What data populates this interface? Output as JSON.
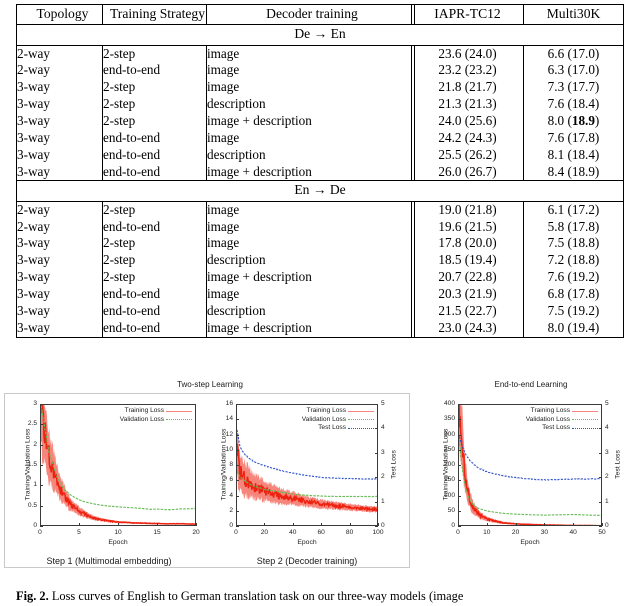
{
  "table": {
    "columns": [
      "Topology",
      "Training Strategy",
      "Decoder training",
      "IAPR-TC12",
      "Multi30K"
    ],
    "sections": [
      {
        "header": "De → En",
        "rows": [
          {
            "topology": "2-way",
            "strategy": "2-step",
            "decoder": "image",
            "iapr": "23.6 (24.0)",
            "iapr_bold": false,
            "multi": "6.6 (17.0)",
            "multi_bold": false,
            "multi_paren_bold": false,
            "iapr_paren_bold": false
          },
          {
            "topology": "2-way",
            "strategy": "end-to-end",
            "decoder": "image",
            "iapr": "23.2 (23.2)",
            "iapr_bold": false,
            "multi": "6.3 (17.0)",
            "multi_bold": false,
            "multi_paren_bold": false,
            "iapr_paren_bold": false
          },
          {
            "topology": "3-way",
            "strategy": "2-step",
            "decoder": "image",
            "iapr": "21.8 (21.7)",
            "iapr_bold": false,
            "multi": "7.3 (17.7)",
            "multi_bold": false,
            "multi_paren_bold": false,
            "iapr_paren_bold": false
          },
          {
            "topology": "3-way",
            "strategy": "2-step",
            "decoder": "description",
            "iapr": "21.3 (21.3)",
            "iapr_bold": false,
            "multi": "7.6 (18.4)",
            "multi_bold": false,
            "multi_paren_bold": false,
            "iapr_paren_bold": false
          },
          {
            "topology": "3-way",
            "strategy": "2-step",
            "decoder": "image + description",
            "iapr": "24.0 (25.6)",
            "iapr_bold": false,
            "multi_main": "8.0 (",
            "multi_paren": "18.9",
            "multi_tail": ")",
            "multi_paren_bold": true,
            "iapr_paren_bold": false
          },
          {
            "topology": "3-way",
            "strategy": "end-to-end",
            "decoder": "image",
            "iapr": "24.2 (24.3)",
            "iapr_bold": false,
            "multi": "7.6 (17.8)",
            "multi_bold": false,
            "multi_paren_bold": false,
            "iapr_paren_bold": false
          },
          {
            "topology": "3-way",
            "strategy": "end-to-end",
            "decoder": "description",
            "iapr": "25.5 (26.2)",
            "iapr_bold": false,
            "multi": "8.1 (18.4)",
            "multi_bold": false,
            "multi_paren_bold": false,
            "iapr_paren_bold": false
          },
          {
            "topology": "3-way",
            "strategy": "end-to-end",
            "decoder": "image + description",
            "iapr": "26.0 (26.7)",
            "iapr_bold": true,
            "multi": "8.4 (18.9)",
            "multi_bold": true,
            "multi_paren_bold": false,
            "iapr_paren_bold": false
          }
        ]
      },
      {
        "header": "En → De",
        "rows": [
          {
            "topology": "2-way",
            "strategy": "2-step",
            "decoder": "image",
            "iapr": "19.0 (21.8)",
            "iapr_bold": false,
            "multi": "6.1 (17.2)",
            "multi_bold": false
          },
          {
            "topology": "2-way",
            "strategy": "end-to-end",
            "decoder": "image",
            "iapr": "19.6 (21.5)",
            "iapr_bold": false,
            "multi": "5.8 (17.8)",
            "multi_bold": false
          },
          {
            "topology": "3-way",
            "strategy": "2-step",
            "decoder": "image",
            "iapr": "17.8 (20.0)",
            "iapr_bold": false,
            "multi": "7.5 (18.8)",
            "multi_bold": false
          },
          {
            "topology": "3-way",
            "strategy": "2-step",
            "decoder": "description",
            "iapr": "18.5 (19.4)",
            "iapr_bold": false,
            "multi": "7.2 (18.8)",
            "multi_bold": false
          },
          {
            "topology": "3-way",
            "strategy": "2-step",
            "decoder": "image + description",
            "iapr": "20.7 (22.8)",
            "iapr_bold": false,
            "multi": "7.6 (19.2)",
            "multi_bold": false
          },
          {
            "topology": "3-way",
            "strategy": "end-to-end",
            "decoder": "image",
            "iapr": "20.3 (21.9)",
            "iapr_bold": false,
            "multi": "6.8 (17.8)",
            "multi_bold": false
          },
          {
            "topology": "3-way",
            "strategy": "end-to-end",
            "decoder": "description",
            "iapr": "21.5 (22.7)",
            "iapr_bold": false,
            "multi": "7.5 (19.2)",
            "multi_bold": false
          },
          {
            "topology": "3-way",
            "strategy": "end-to-end",
            "decoder": "image + description",
            "iapr": "23.0 (24.3)",
            "iapr_bold": true,
            "multi": "8.0 (19.4)",
            "multi_bold": true
          }
        ]
      }
    ]
  },
  "figure": {
    "panel_left_title": "Two-step Learning",
    "panel_right_title": "End-to-end Learning",
    "sub_caption_1": "Step 1 (Multimodal embedding)",
    "sub_caption_2": "Step 2 (Decoder training)",
    "caption": "Fig. 2. Loss curves of English to German translation task on our three-way models (image",
    "caption_prefix": "Fig. 2.",
    "colors": {
      "training": "#ee2211",
      "validation": "#66bb55",
      "test": "#3355cc",
      "axis": "#3a3a3a"
    }
  },
  "chart_data": [
    {
      "type": "line",
      "id": "step1",
      "title": "Step 1 (Multimodal embedding)",
      "xlabel": "Epoch",
      "ylabel": "Training/Validation Loss",
      "xlim": [
        0,
        20
      ],
      "ylim": [
        0,
        3
      ],
      "xticks": [
        0,
        5,
        10,
        15,
        20
      ],
      "yticks": [
        0,
        0.5,
        1,
        1.5,
        2,
        2.5,
        3
      ],
      "grid": false,
      "legend": [
        "Training Loss",
        "Validation Loss"
      ],
      "legend_position": "top-right",
      "series": [
        {
          "name": "Training Loss",
          "color": "#ee2211",
          "x": [
            0,
            0.5,
            1,
            1.5,
            2,
            2.5,
            3,
            3.5,
            4,
            5,
            6,
            7,
            8,
            9,
            10,
            12,
            14,
            16,
            18,
            20
          ],
          "values": [
            3.0,
            2.3,
            1.75,
            1.45,
            1.2,
            0.95,
            0.78,
            0.62,
            0.52,
            0.38,
            0.28,
            0.21,
            0.17,
            0.14,
            0.12,
            0.1,
            0.09,
            0.08,
            0.08,
            0.07
          ],
          "noisy": true
        },
        {
          "name": "Validation Loss",
          "color": "#66bb55",
          "x": [
            0,
            1,
            2,
            3,
            4,
            5,
            6,
            7,
            8,
            9,
            10,
            11,
            12,
            13,
            14,
            15,
            16,
            17,
            18,
            19,
            20
          ],
          "values": [
            3.0,
            1.85,
            1.25,
            0.92,
            0.76,
            0.66,
            0.6,
            0.56,
            0.53,
            0.51,
            0.495,
            0.48,
            0.47,
            0.455,
            0.435,
            0.44,
            0.425,
            0.43,
            0.445,
            0.45,
            0.45
          ],
          "noisy": false
        }
      ]
    },
    {
      "type": "line",
      "id": "step2",
      "title": "Step 2 (Decoder training)",
      "xlabel": "Epoch",
      "ylabel": "Training/Validation Loss",
      "y2label": "Test Loss",
      "xlim": [
        0,
        100
      ],
      "ylim": [
        0,
        16
      ],
      "y2lim": [
        0,
        5
      ],
      "xticks": [
        0,
        20,
        40,
        60,
        80,
        100
      ],
      "yticks": [
        0,
        2,
        4,
        6,
        8,
        10,
        12,
        14,
        16
      ],
      "y2ticks": [
        0,
        1,
        2,
        3,
        4,
        5
      ],
      "grid": false,
      "legend": [
        "Training Loss",
        "Validation Loss",
        "Test Loss"
      ],
      "legend_position": "top-right",
      "series": [
        {
          "name": "Training Loss",
          "color": "#ee2211",
          "axis": "left",
          "x": [
            0,
            2,
            5,
            10,
            15,
            20,
            30,
            40,
            50,
            60,
            70,
            80,
            90,
            100
          ],
          "values": [
            10.0,
            7.2,
            6.4,
            5.6,
            5.1,
            4.7,
            4.1,
            3.7,
            3.3,
            3.0,
            2.8,
            2.6,
            2.4,
            2.3
          ],
          "noisy": true
        },
        {
          "name": "Validation Loss",
          "color": "#66bb55",
          "axis": "left",
          "x": [
            0,
            2,
            5,
            10,
            15,
            20,
            30,
            40,
            50,
            60,
            70,
            80,
            90,
            100
          ],
          "values": [
            7.4,
            6.6,
            6.1,
            5.5,
            5.2,
            4.9,
            4.6,
            4.3,
            4.15,
            4.05,
            4.0,
            4.0,
            4.0,
            4.0
          ],
          "noisy": false
        },
        {
          "name": "Test Loss",
          "color": "#3355cc",
          "axis": "right",
          "x": [
            0,
            2,
            5,
            10,
            15,
            20,
            30,
            40,
            50,
            60,
            70,
            80,
            90,
            100
          ],
          "values": [
            4.0,
            3.3,
            3.0,
            2.75,
            2.6,
            2.5,
            2.32,
            2.2,
            2.1,
            2.03,
            2.0,
            1.98,
            1.97,
            1.97
          ],
          "noisy": false
        }
      ]
    },
    {
      "type": "line",
      "id": "end-to-end",
      "title": "End-to-end Learning",
      "xlabel": "Epoch",
      "ylabel": "Training/Validation Loss",
      "y2label": "Test Loss",
      "xlim": [
        0,
        50
      ],
      "ylim": [
        0,
        400
      ],
      "y2lim": [
        0,
        5
      ],
      "xticks": [
        0,
        10,
        20,
        30,
        40,
        50
      ],
      "yticks": [
        0,
        50,
        100,
        150,
        200,
        250,
        300,
        350,
        400
      ],
      "y2ticks": [
        0,
        1,
        2,
        3,
        4,
        5
      ],
      "grid": false,
      "legend": [
        "Training Loss",
        "Validation Loss",
        "Test Loss"
      ],
      "legend_position": "top-right",
      "series": [
        {
          "name": "Training Loss",
          "color": "#ee2211",
          "axis": "left",
          "x": [
            0,
            1,
            2,
            3,
            4,
            5,
            7,
            10,
            15,
            20,
            25,
            30,
            35,
            40,
            45,
            50
          ],
          "values": [
            400,
            300,
            180,
            120,
            85,
            62,
            40,
            25,
            14,
            10,
            8,
            7,
            6,
            5,
            5,
            4
          ],
          "noisy": true
        },
        {
          "name": "Validation Loss",
          "color": "#66bb55",
          "axis": "left",
          "x": [
            0,
            1,
            2,
            3,
            4,
            5,
            7,
            10,
            15,
            20,
            25,
            30,
            35,
            40,
            45,
            50
          ],
          "values": [
            300,
            200,
            140,
            105,
            85,
            72,
            60,
            52,
            45,
            42,
            40,
            39,
            40,
            41,
            39,
            38
          ],
          "noisy": false
        },
        {
          "name": "Test Loss",
          "color": "#3355cc",
          "axis": "right",
          "x": [
            0,
            1,
            2,
            3,
            4,
            5,
            7,
            10,
            15,
            20,
            25,
            30,
            35,
            40,
            45,
            50
          ],
          "values": [
            3.72,
            3.35,
            3.05,
            2.85,
            2.7,
            2.58,
            2.4,
            2.25,
            2.1,
            2.02,
            1.96,
            1.93,
            1.95,
            1.97,
            1.97,
            1.98
          ],
          "noisy": false
        }
      ]
    }
  ]
}
